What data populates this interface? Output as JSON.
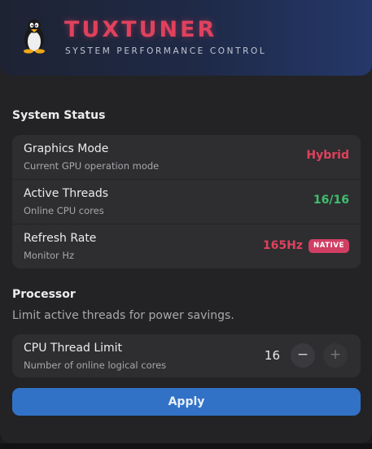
{
  "header": {
    "title": "TUXTUNER",
    "subtitle": "SYSTEM PERFORMANCE CONTROL",
    "logo_icon": "tux-penguin-icon"
  },
  "status": {
    "section_title": "System Status",
    "rows": [
      {
        "label": "Graphics Mode",
        "sub": "Current GPU operation mode",
        "value": "Hybrid"
      },
      {
        "label": "Active Threads",
        "sub": "Online CPU cores",
        "value": "16/16"
      },
      {
        "label": "Refresh Rate",
        "sub": "Monitor Hz",
        "value": "165Hz",
        "badge": "NATIVE"
      }
    ]
  },
  "processor": {
    "section_title": "Processor",
    "description": "Limit active threads for power savings.",
    "cpu_limit": {
      "label": "CPU Thread Limit",
      "sub": "Number of online logical cores",
      "value": "16",
      "minus_icon": "minus-icon",
      "plus_icon": "plus-icon"
    }
  },
  "apply_label": "Apply",
  "colors": {
    "accent_red": "#e0415d",
    "accent_green": "#3fbf6e",
    "accent_blue": "#3172c6",
    "badge_bg": "#d03f63"
  }
}
